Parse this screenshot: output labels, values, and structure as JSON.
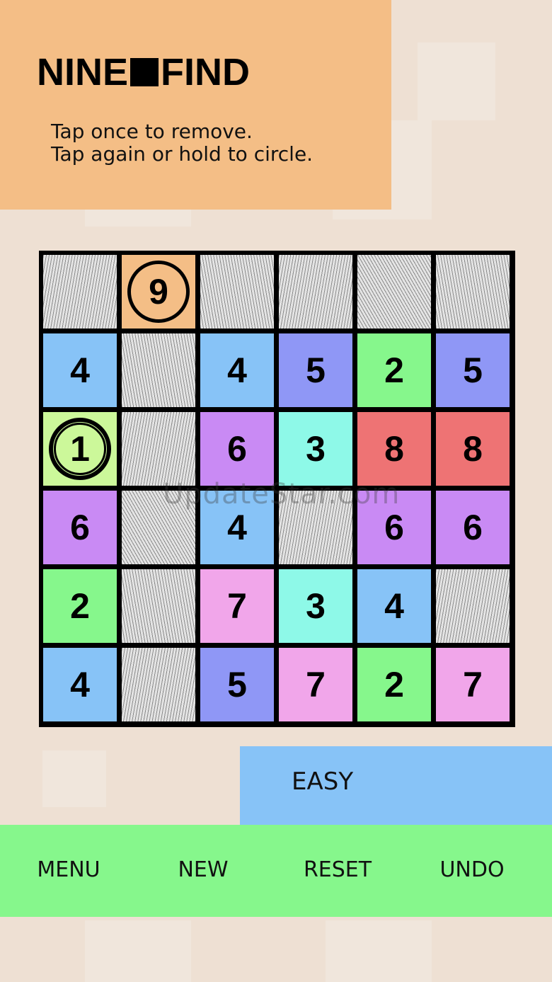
{
  "header": {
    "title_left": "NINE",
    "title_right": "FIND",
    "instructions": [
      "Tap once to remove.",
      "Tap again or hold to circle."
    ],
    "color": "#f4be86"
  },
  "board": {
    "colors": {
      "1": "#ccf89a",
      "2": "#86f78c",
      "3": "#8ef9e8",
      "4": "#87c3f7",
      "5": "#8f97f6",
      "6": "#c98af4",
      "7": "#f1a6ea",
      "8": "#ee7374",
      "9": "#f4be86"
    },
    "cells": [
      [
        {
          "state": "removed"
        },
        {
          "value": "9",
          "state": "circled"
        },
        {
          "state": "removed"
        },
        {
          "state": "removed"
        },
        {
          "state": "removed"
        },
        {
          "state": "removed"
        }
      ],
      [
        {
          "value": "4"
        },
        {
          "state": "removed"
        },
        {
          "value": "4"
        },
        {
          "value": "5"
        },
        {
          "value": "2"
        },
        {
          "value": "5"
        }
      ],
      [
        {
          "value": "1",
          "state": "circled-double"
        },
        {
          "state": "removed"
        },
        {
          "value": "6"
        },
        {
          "value": "3"
        },
        {
          "value": "8"
        },
        {
          "value": "8"
        }
      ],
      [
        {
          "value": "6"
        },
        {
          "state": "removed"
        },
        {
          "value": "4"
        },
        {
          "state": "removed"
        },
        {
          "value": "6"
        },
        {
          "value": "6"
        }
      ],
      [
        {
          "value": "2"
        },
        {
          "state": "removed"
        },
        {
          "value": "7"
        },
        {
          "value": "3"
        },
        {
          "value": "4"
        },
        {
          "state": "removed"
        }
      ],
      [
        {
          "value": "4"
        },
        {
          "state": "removed"
        },
        {
          "value": "5"
        },
        {
          "value": "7"
        },
        {
          "value": "2"
        },
        {
          "value": "7"
        }
      ]
    ]
  },
  "watermark": "UpdateStar.com",
  "difficulty": {
    "label": "EASY",
    "color": "#87c3f7"
  },
  "toolbar": {
    "menu": "MENU",
    "new": "NEW",
    "reset": "RESET",
    "undo": "UNDO",
    "color": "#86f78c"
  }
}
